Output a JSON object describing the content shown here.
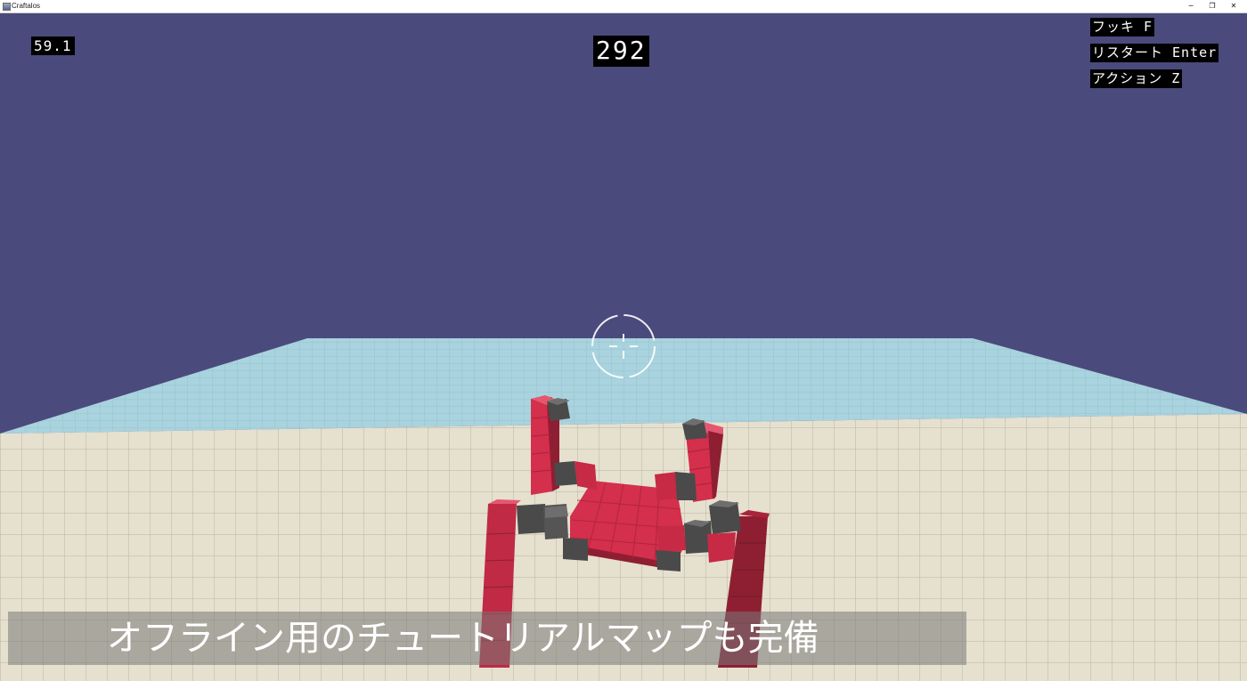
{
  "window": {
    "title": "Craftalos",
    "minimize_label": "─",
    "maximize_label": "❐",
    "close_label": "✕"
  },
  "hud": {
    "fps": "59.1",
    "score": "292",
    "controls": [
      {
        "action": "フッキ",
        "key": "F"
      },
      {
        "action": "リスタート",
        "key": "Enter"
      },
      {
        "action": "アクション",
        "key": "Z"
      }
    ]
  },
  "subtitle": {
    "text": "オフライン用のチュートリアルマップも完備"
  },
  "colors": {
    "sky": "#4b4a7c",
    "water": "#a9d3de",
    "floor": "#e6e0cf",
    "robot_body": "#d42f4c",
    "robot_joint": "#4a4a4a",
    "hud_bg": "#000000",
    "hud_text": "#ffffff"
  },
  "icons": {
    "crosshair": "crosshair-icon",
    "app": "app-icon"
  }
}
